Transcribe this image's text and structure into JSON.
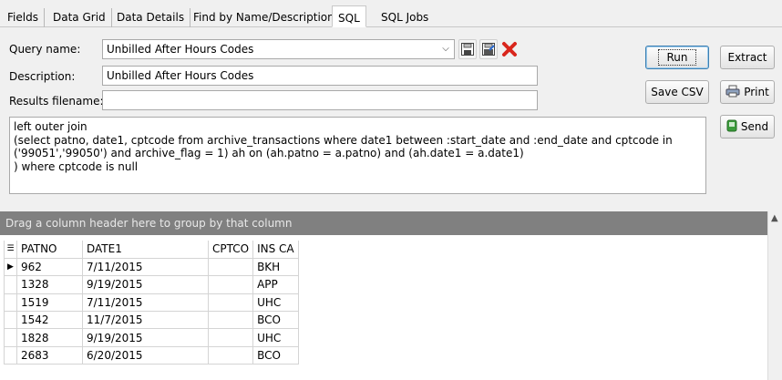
{
  "tabs": [
    "Fields",
    "Data Grid",
    "Data Details",
    "Find by Name/Description",
    "SQL",
    "SQL Jobs"
  ],
  "active_tab": "SQL",
  "form": {
    "query_name_label": "Query name:",
    "query_name_value": "Unbilled After Hours Codes",
    "description_label": "Description:",
    "description_value": "Unbilled After Hours Codes",
    "results_filename_label": "Results filename:",
    "results_filename_value": ""
  },
  "buttons": {
    "run": "Run",
    "extract": "Extract",
    "save_csv": "Save CSV",
    "print": "Print",
    "send": "Send"
  },
  "sql_text": "left outer join\n(select patno, date1, cptcode from archive_transactions where date1 between :start_date and :end_date and cptcode in\n('99051','99050') and archive_flag = 1) ah on (ah.patno = a.patno) and (ah.date1 = a.date1)\n) where cptcode is null",
  "grid": {
    "group_hint": "Drag a column header here to group by that column",
    "columns": [
      "PATNO",
      "DATE1",
      "CPTCO",
      "INS CA"
    ],
    "rows": [
      [
        "962",
        "7/11/2015",
        "",
        "BKH"
      ],
      [
        "1328",
        "9/19/2015",
        "",
        "APP"
      ],
      [
        "1519",
        "7/11/2015",
        "",
        "UHC"
      ],
      [
        "1542",
        "11/7/2015",
        "",
        "BCO"
      ],
      [
        "1828",
        "9/19/2015",
        "",
        "UHC"
      ],
      [
        "2683",
        "6/20/2015",
        "",
        "BCO"
      ]
    ],
    "current_row_index": 0
  },
  "colors": {
    "group_bar": "#808080",
    "delete_icon": "#d9261c",
    "send_icon": "#3b9b3b"
  }
}
